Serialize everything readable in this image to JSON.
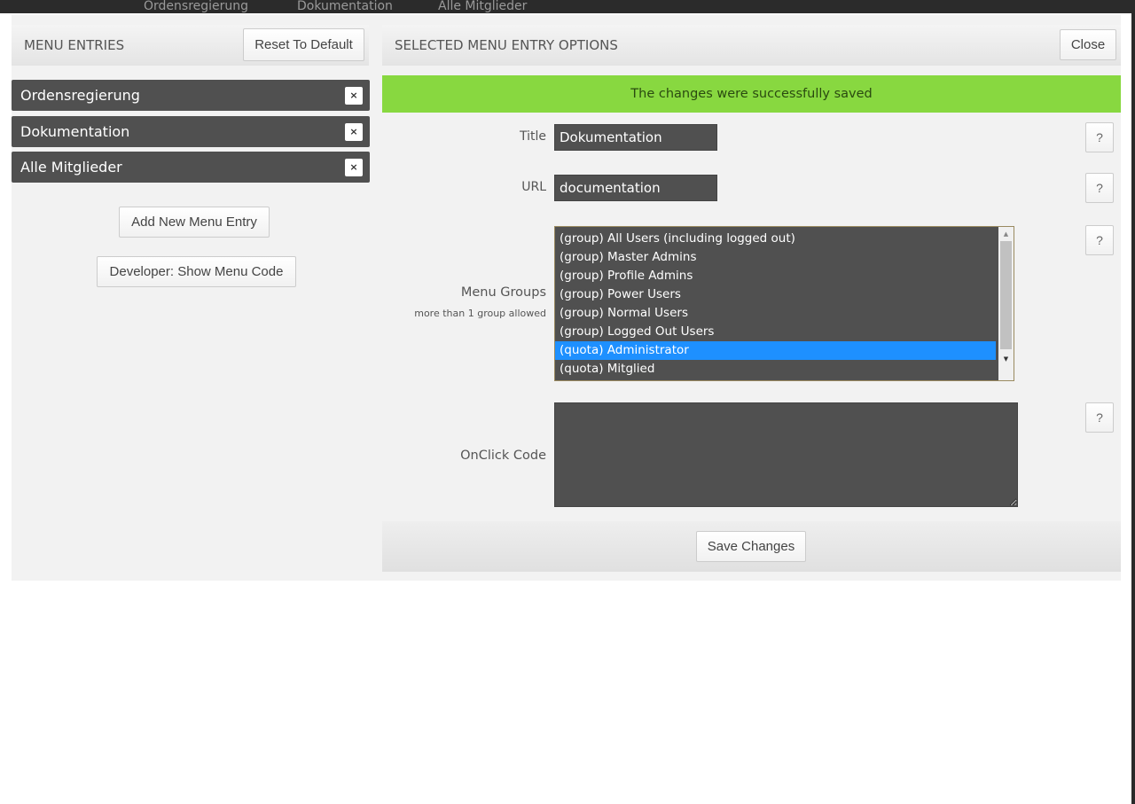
{
  "background_nav": [
    "Ordensregierung",
    "Dokumentation",
    "Alle Mitglieder"
  ],
  "left": {
    "header": "MENU ENTRIES",
    "reset_label": "Reset To Default",
    "entries": [
      {
        "label": "Ordensregierung",
        "remove": "×"
      },
      {
        "label": "Dokumentation",
        "remove": "×"
      },
      {
        "label": "Alle Mitglieder",
        "remove": "×"
      }
    ],
    "add_label": "Add New Menu Entry",
    "dev_label": "Developer: Show Menu Code"
  },
  "right": {
    "header": "SELECTED MENU ENTRY OPTIONS",
    "close_label": "Close",
    "success": "The changes were successfully saved",
    "title_label": "Title",
    "title_value": "Dokumentation",
    "url_label": "URL",
    "url_value": "documentation",
    "groups_label": "Menu Groups",
    "groups_hint": "more than 1 group allowed",
    "groups": [
      "(group) All Users (including logged out)",
      "(group) Master Admins",
      "(group) Profile Admins",
      "(group) Power Users",
      "(group) Normal Users",
      "(group) Logged Out Users",
      "(quota) Administrator",
      "(quota) Mitglied"
    ],
    "selected_group": "(quota) Administrator",
    "onclick_label": "OnClick Code",
    "onclick_value": "",
    "help": "?",
    "save_label": "Save Changes"
  },
  "colors": {
    "success": "#88d840",
    "selected": "#1e90ff",
    "dark": "#505050"
  }
}
